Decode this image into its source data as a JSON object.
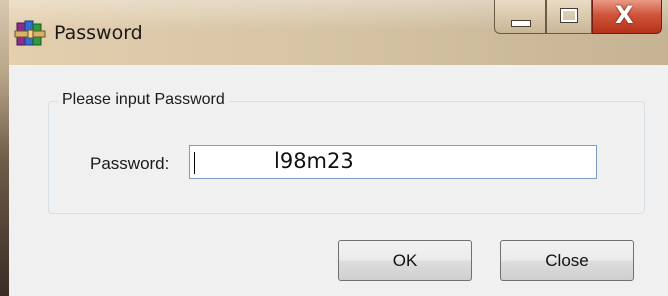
{
  "window": {
    "title": "Password",
    "icon": "winrar-books-icon",
    "controls": {
      "minimize": "minimize-icon",
      "maximize": "maximize-icon",
      "close": "close-icon",
      "close_glyph": "X"
    }
  },
  "form": {
    "group_title": "Please input Password",
    "password_label": "Password:",
    "password_value": "l98m23"
  },
  "buttons": {
    "ok": "OK",
    "close": "Close"
  },
  "colors": {
    "titlebar": "#d7c5a6",
    "close_button": "#c94a32",
    "input_border": "#7a9cc5",
    "dialog_bg": "#f0f0f0"
  }
}
